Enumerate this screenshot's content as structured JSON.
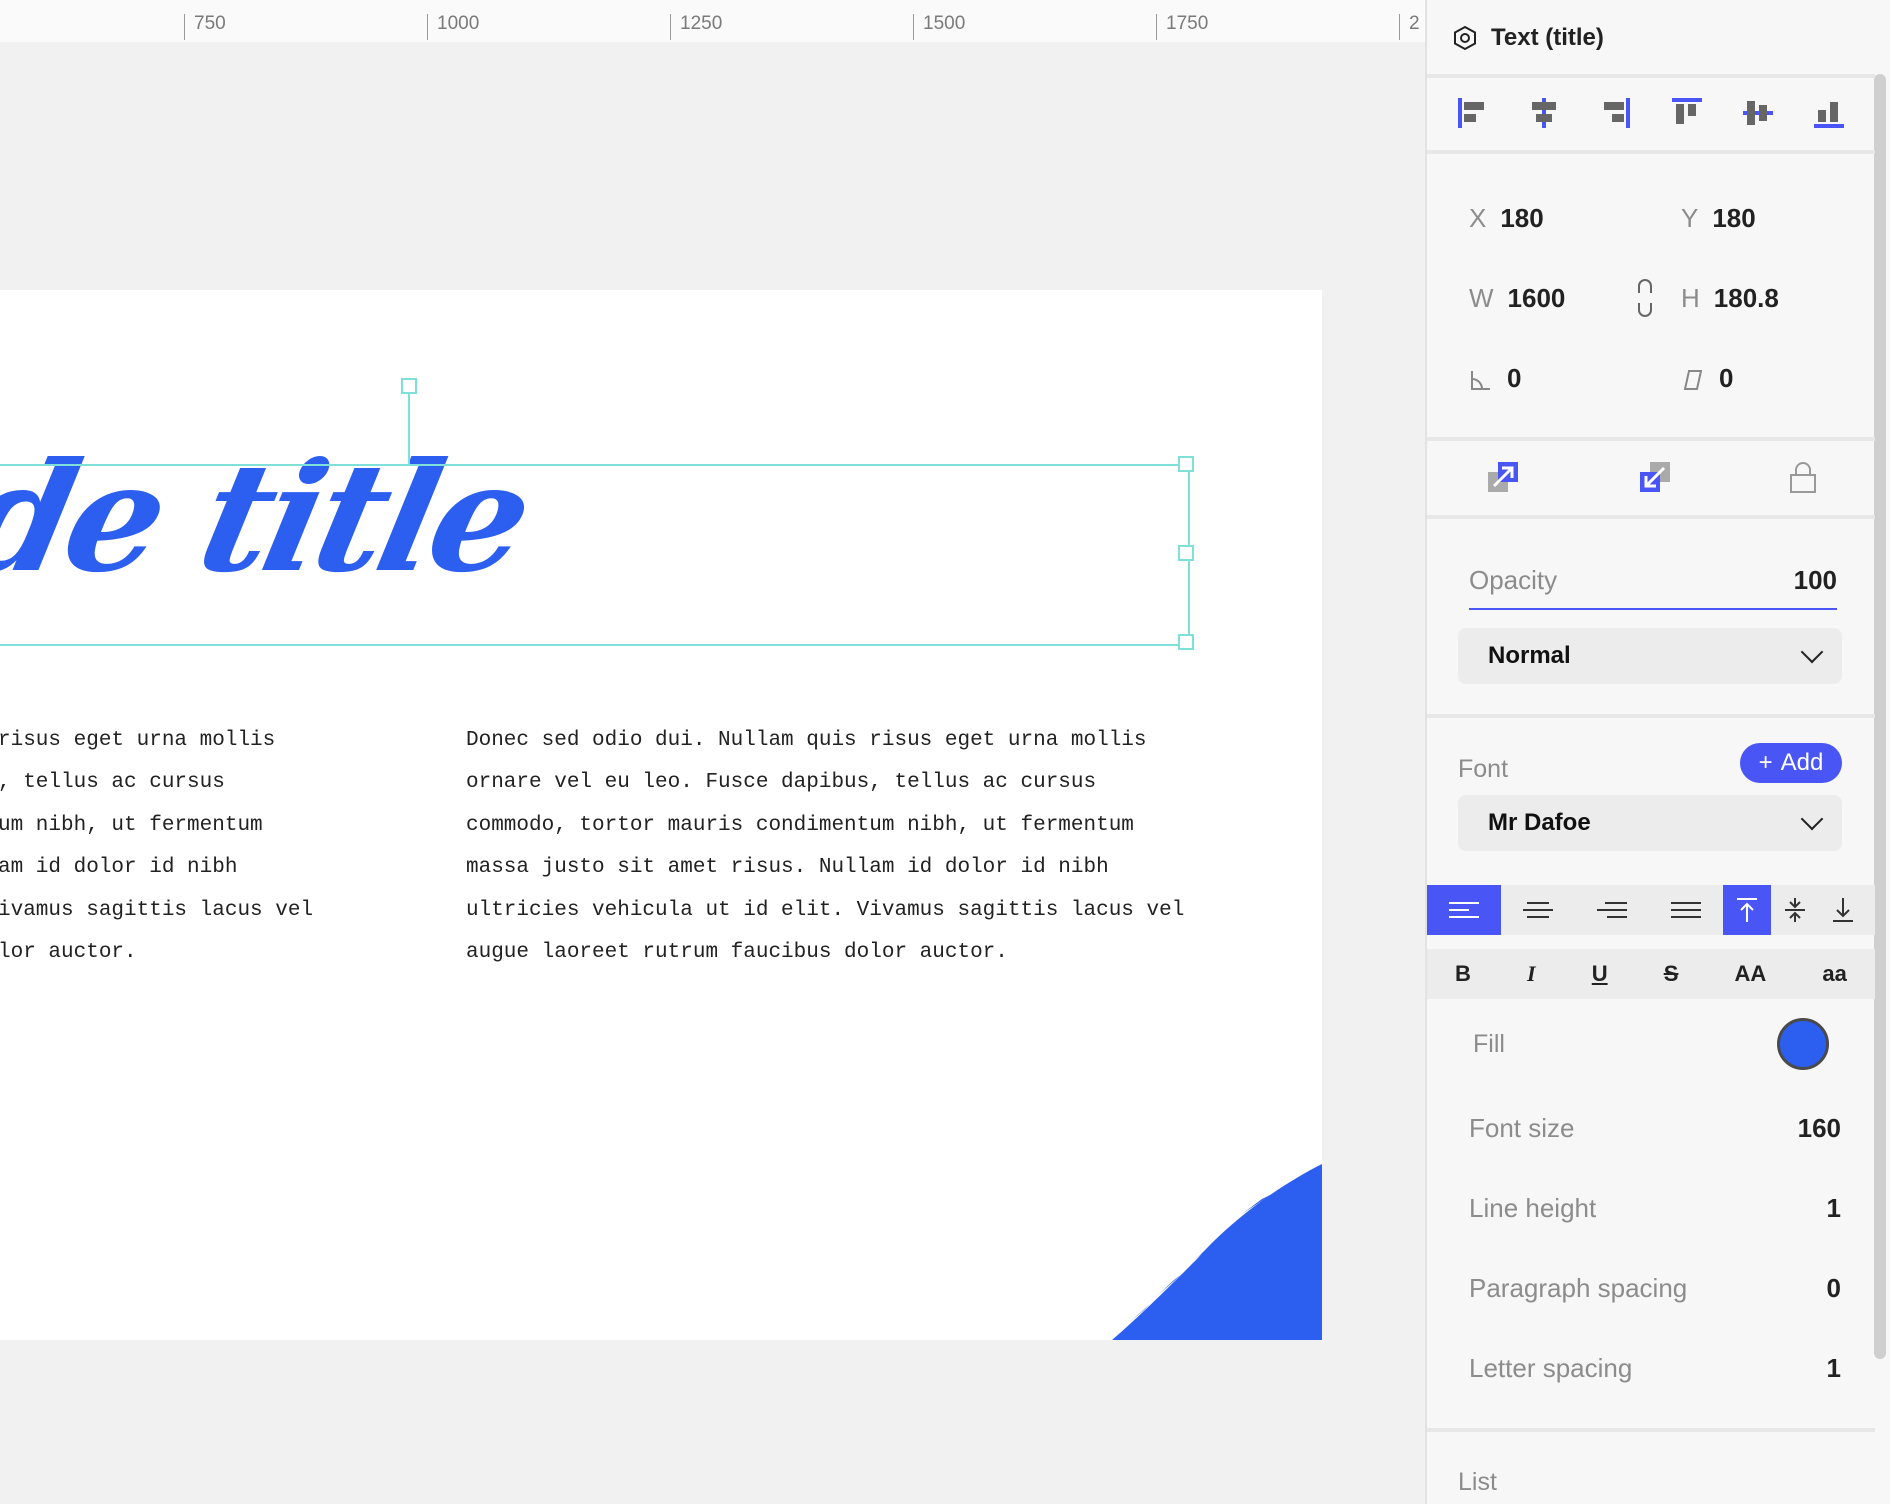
{
  "ruler": {
    "ticks": [
      "750",
      "1000",
      "1250",
      "1500",
      "1750",
      "2"
    ]
  },
  "slide": {
    "title": "de title",
    "left_column": [
      "risus eget urna mollis",
      ", tellus ac cursus",
      "um nibh, ut fermentum",
      "am id dolor id nibh",
      "ivamus sagittis lacus vel",
      "lor auctor."
    ],
    "right_column": [
      "Donec sed odio dui. Nullam quis risus eget urna mollis",
      "ornare vel eu leo. Fusce dapibus, tellus ac cursus",
      "commodo, tortor mauris condimentum nibh, ut fermentum",
      "massa justo sit amet risus. Nullam id dolor id nibh",
      "ultricies vehicula ut id elit. Vivamus sagittis lacus vel",
      "augue laoreet rutrum faucibus dolor auctor."
    ]
  },
  "panel": {
    "header": "Text (title)",
    "geometry": {
      "x_label": "X",
      "x": "180",
      "y_label": "Y",
      "y": "180",
      "w_label": "W",
      "w": "1600",
      "h_label": "H",
      "h": "180.8",
      "rotation": "0",
      "skew": "0"
    },
    "opacity_label": "Opacity",
    "opacity": "100",
    "blend_mode": "Normal",
    "font_label": "Font",
    "add_label": "Add",
    "font_name": "Mr Dafoe",
    "style_buttons": {
      "bold": "B",
      "italic": "I",
      "underline": "U",
      "strike": "S",
      "upper": "AA",
      "lower": "aa"
    },
    "fill_label": "Fill",
    "fill_color": "#2c5ff0",
    "font_size_label": "Font size",
    "font_size": "160",
    "line_height_label": "Line height",
    "line_height": "1",
    "paragraph_spacing_label": "Paragraph spacing",
    "paragraph_spacing": "0",
    "letter_spacing_label": "Letter spacing",
    "letter_spacing": "1",
    "list_label": "List"
  },
  "colors": {
    "accent": "#4a55f5",
    "selection": "#7fe0d9",
    "brand_blue": "#2c5ff0"
  }
}
